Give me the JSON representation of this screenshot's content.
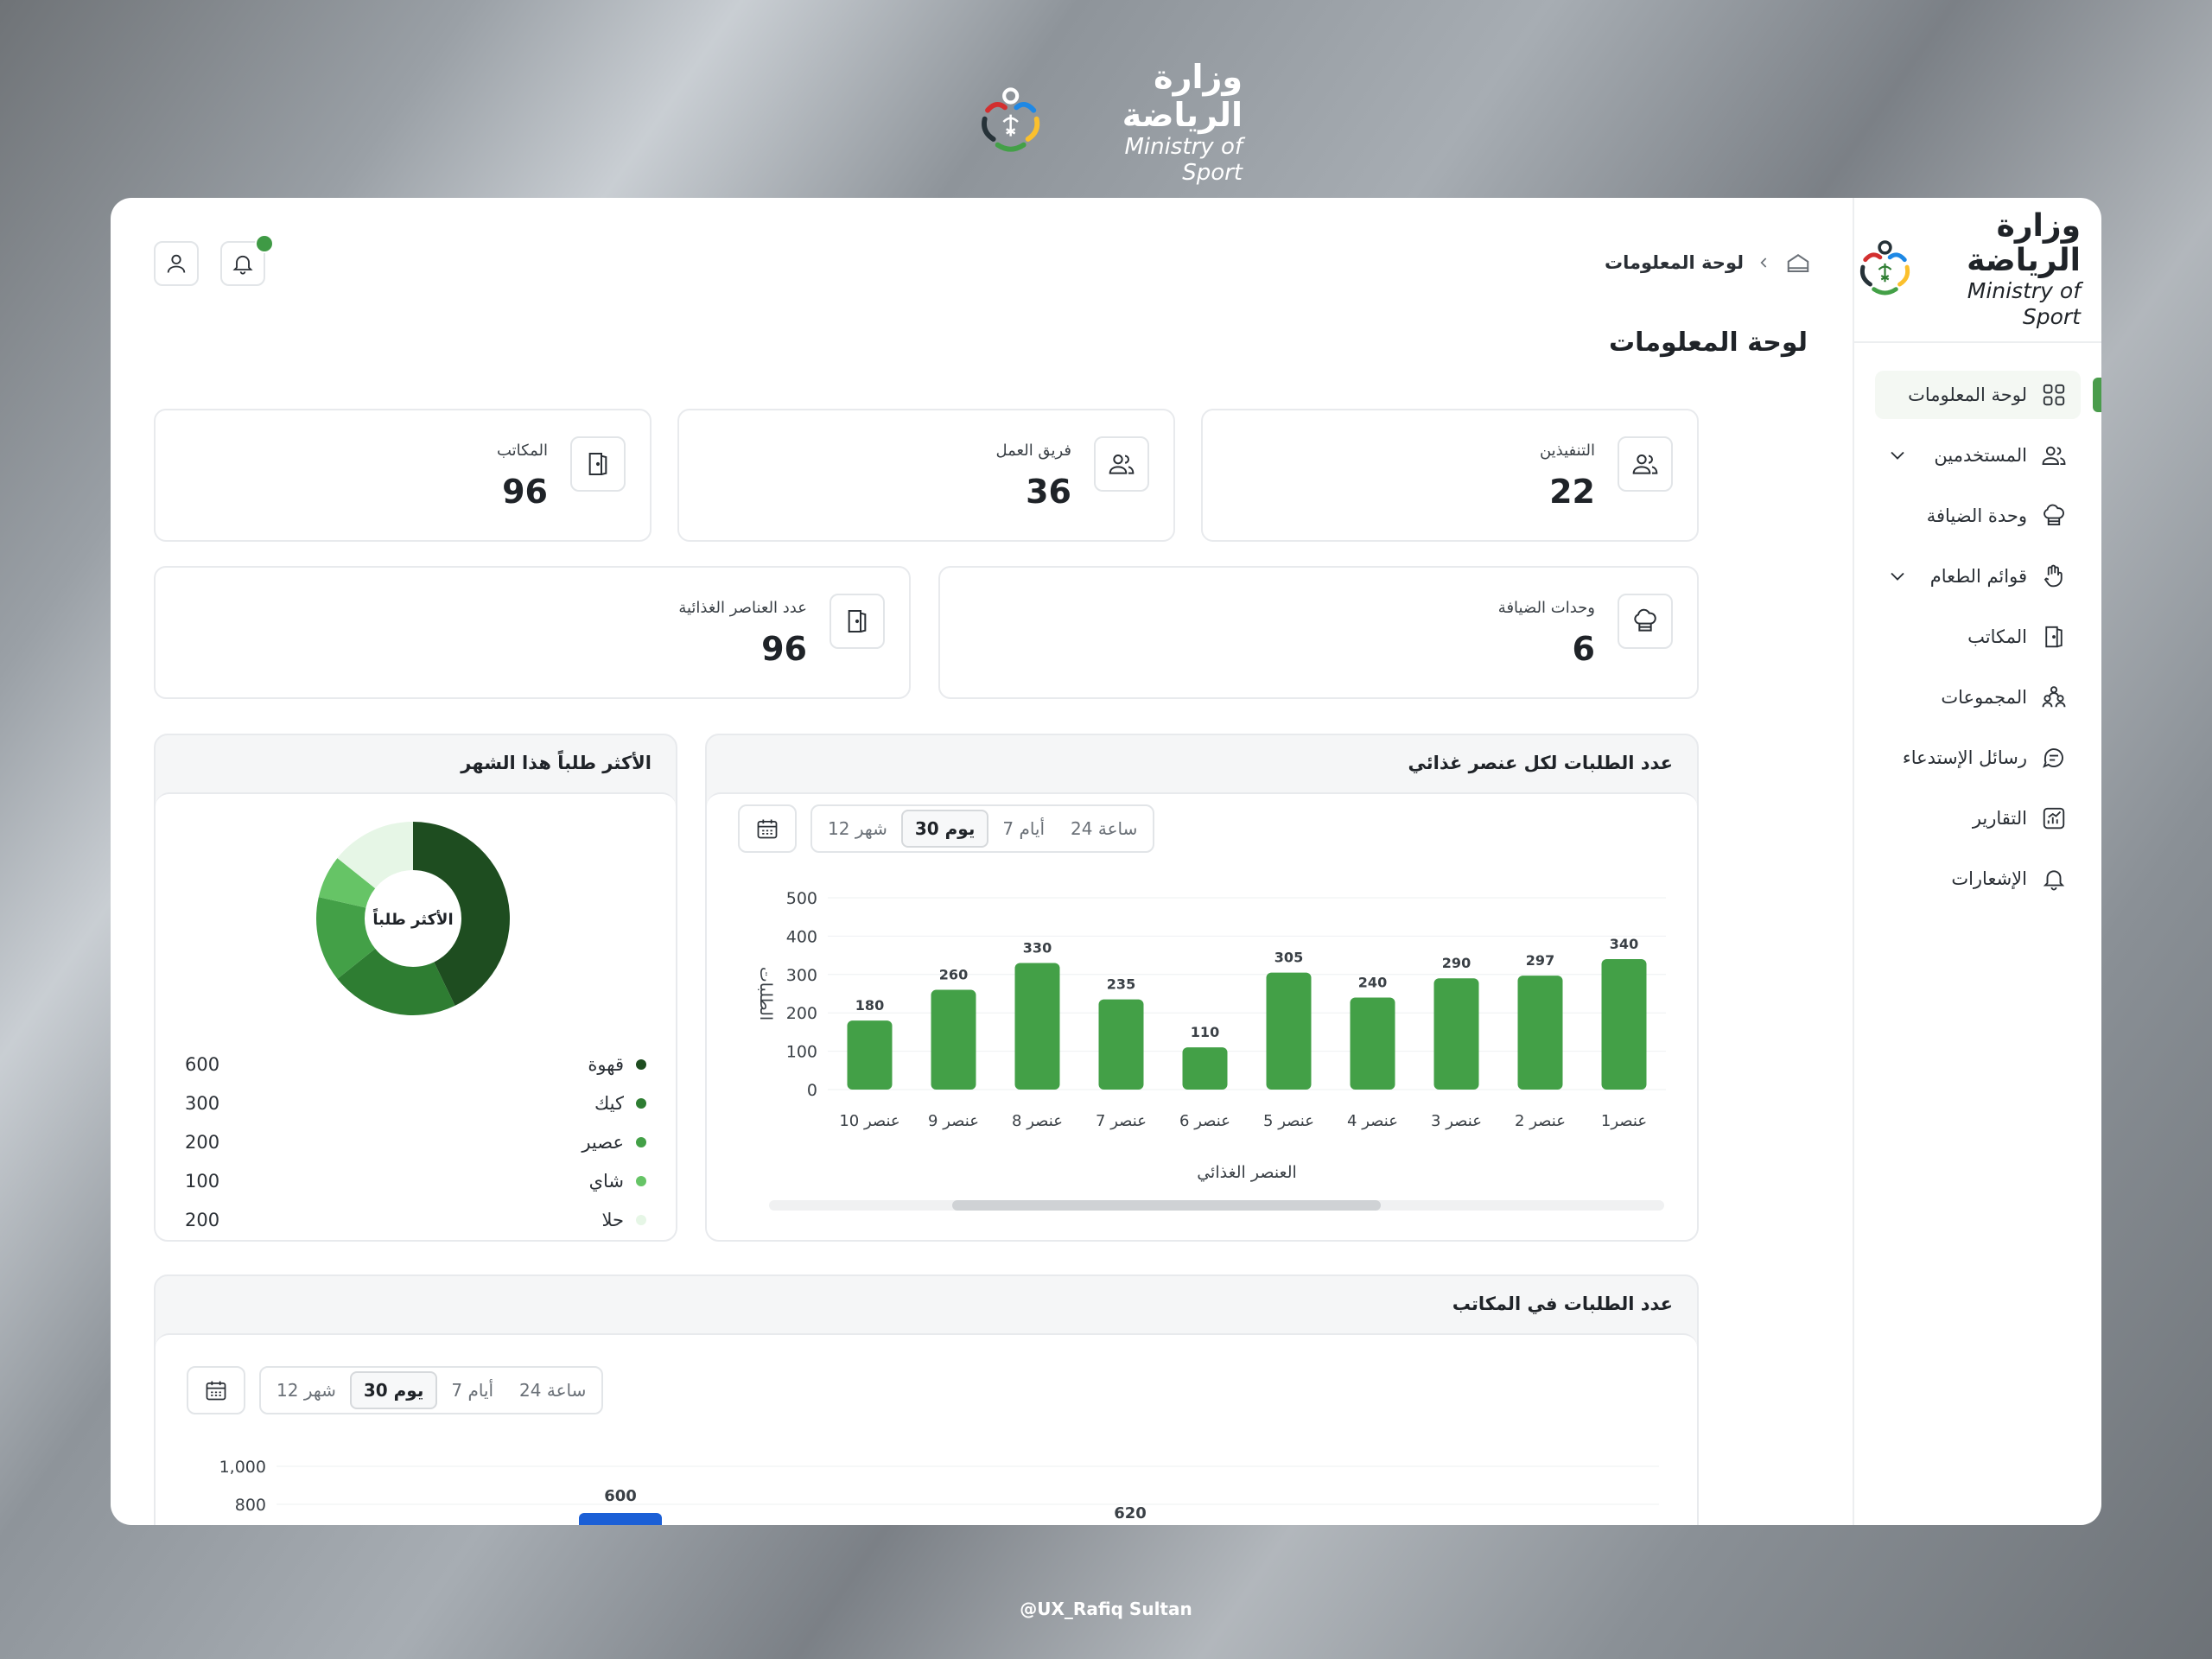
{
  "brand": {
    "name_ar": "وزارة الرياضة",
    "name_en": "Ministry of Sport"
  },
  "credit": "@UX_Rafiq Sultan",
  "header": {
    "breadcrumb": "لوحة المعلومات"
  },
  "page_title": "لوحة المعلومات",
  "sidebar": {
    "items": [
      {
        "label": "لوحة المعلومات",
        "icon": "grid-icon",
        "active": true
      },
      {
        "label": "المستخدمين",
        "icon": "users-icon",
        "expandable": true
      },
      {
        "label": "وحدة الضيافة",
        "icon": "chef-hat-icon"
      },
      {
        "label": "قوائم الطعام",
        "icon": "menu-hand-icon",
        "expandable": true
      },
      {
        "label": "المكاتب",
        "icon": "door-icon"
      },
      {
        "label": "المجموعات",
        "icon": "group-icon"
      },
      {
        "label": "رسائل الإستدعاء",
        "icon": "chat-icon"
      },
      {
        "label": "التقارير",
        "icon": "report-icon"
      },
      {
        "label": "الإشعارات",
        "icon": "bell-icon"
      }
    ]
  },
  "stats": [
    {
      "label": "التنفيذين",
      "value": "22",
      "icon": "users-icon"
    },
    {
      "label": "فريق العمل",
      "value": "36",
      "icon": "users-icon"
    },
    {
      "label": "المكاتب",
      "value": "96",
      "icon": "door-icon"
    },
    {
      "label": "وحدات الضيافة",
      "value": "6",
      "icon": "chef-hat-icon"
    },
    {
      "label": "عدد العناصر الغذائية",
      "value": "96",
      "icon": "door-icon"
    }
  ],
  "time_filters": [
    "24 ساعة",
    "7 أيام",
    "30 يوم",
    "12 شهر"
  ],
  "time_filter_selected": "30 يوم",
  "colors": {
    "accent": "#4a9c4c",
    "bar": "#43a047",
    "blue": "#1b5fd6"
  },
  "panels": {
    "items_chart_title": "عدد الطلبات لكل عنصر غذائي",
    "top_title": "الأكثر طلباً هذا الشهر",
    "donut_center": "الأكثر طلباً",
    "offices_title": "عدد الطلبات في المكاتب"
  },
  "chart_data": [
    {
      "type": "bar",
      "title": "عدد الطلبات لكل عنصر غذائي",
      "categories": [
        "عنصر1",
        "عنصر 2",
        "عنصر 3",
        "عنصر 4",
        "عنصر 5",
        "عنصر 6",
        "عنصر 7",
        "عنصر 8",
        "عنصر 9",
        "عنصر 10"
      ],
      "values": [
        340,
        297,
        290,
        240,
        305,
        110,
        235,
        330,
        260,
        180
      ],
      "xlabel": "العنصر الغذائي",
      "ylabel": "الطلبات",
      "ylim": [
        0,
        500
      ],
      "yticks": [
        0,
        100,
        200,
        300,
        400,
        500
      ],
      "grid": true
    },
    {
      "type": "pie",
      "title": "الأكثر طلباً هذا الشهر",
      "labels": [
        "قهوة",
        "كيك",
        "عصير",
        "شاي",
        "حلا"
      ],
      "values": [
        600,
        300,
        200,
        100,
        200
      ],
      "colors": [
        "#1e4d20",
        "#2e7d32",
        "#43a047",
        "#66c466",
        "#e6f6e6"
      ]
    },
    {
      "type": "bar",
      "title": "عدد الطلبات في المكاتب",
      "visible_values": [
        600,
        620
      ],
      "yticks": [
        "800",
        "1,000"
      ],
      "grid": true
    }
  ]
}
